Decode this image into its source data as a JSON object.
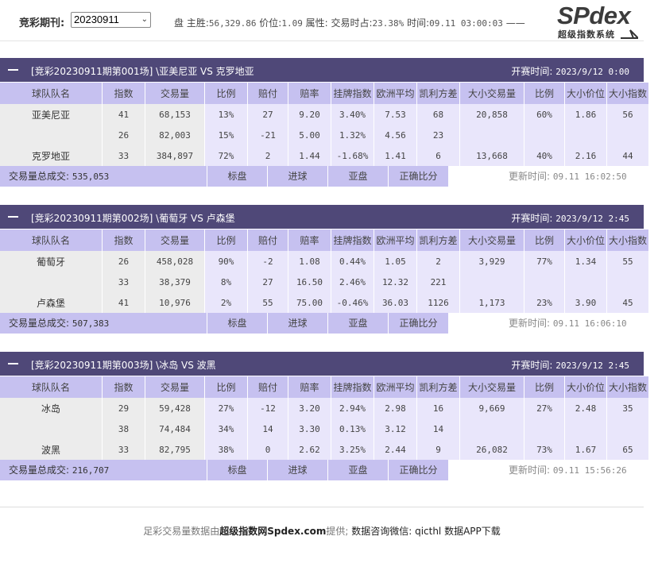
{
  "header": {
    "period_label": "竞彩期刊:",
    "period_value": "20230911",
    "info_prefix": "盘 主胜:",
    "info_main_win": "56,329.86",
    "info_price_label": " 价位:",
    "info_price": "1.09",
    "info_attr_label": " 属性: 交易时占:",
    "info_trade_pct": "23.38%",
    "info_time_label": " 时间:",
    "info_time": "09.11 03:00:03",
    "info_suffix": " ——",
    "logo_main": "SPdex",
    "logo_sub": "超级指数系统"
  },
  "columns": [
    "球队队名",
    "指数",
    "交易量",
    "比例",
    "赔付",
    "赔率",
    "挂牌指数",
    "欧洲平均",
    "凯利方差",
    "大小交易量",
    "比例",
    "大小价位",
    "大小指数"
  ],
  "footer_tabs": [
    "标盘",
    "进球",
    "亚盘",
    "正确比分"
  ],
  "total_label": "交易量总成交:",
  "update_label": "更新时间:",
  "kickoff_label": "开赛时间:",
  "matches": [
    {
      "title": "[竞彩20230911期第001场] \\亚美尼亚 VS 克罗地亚",
      "kickoff": "2023/9/12 0:00",
      "rows": [
        {
          "team": "亚美尼亚",
          "idx": "41",
          "vol": "68,153",
          "ratio": "13%",
          "pay": "27",
          "odds": "9.20",
          "list_idx": "3.40%",
          "eu_avg": "7.53",
          "kelly": "68",
          "ou_vol": "20,858",
          "ou_ratio": "60%",
          "ou_price": "1.86",
          "ou_idx": "56"
        },
        {
          "team": "",
          "idx": "26",
          "vol": "82,003",
          "ratio": "15%",
          "pay": "-21",
          "odds": "5.00",
          "list_idx": "1.32%",
          "eu_avg": "4.56",
          "kelly": "23",
          "ou_vol": "",
          "ou_ratio": "",
          "ou_price": "",
          "ou_idx": ""
        },
        {
          "team": "克罗地亚",
          "idx": "33",
          "vol": "384,897",
          "ratio": "72%",
          "pay": "2",
          "odds": "1.44",
          "list_idx": "-1.68%",
          "eu_avg": "1.41",
          "kelly": "6",
          "ou_vol": "13,668",
          "ou_ratio": "40%",
          "ou_price": "2.16",
          "ou_idx": "44"
        }
      ],
      "total": "535,053",
      "update": "09.11 16:02:50"
    },
    {
      "title": "[竞彩20230911期第002场] \\葡萄牙 VS 卢森堡",
      "kickoff": "2023/9/12 2:45",
      "rows": [
        {
          "team": "葡萄牙",
          "idx": "26",
          "vol": "458,028",
          "ratio": "90%",
          "pay": "-2",
          "odds": "1.08",
          "list_idx": "0.44%",
          "eu_avg": "1.05",
          "kelly": "2",
          "ou_vol": "3,929",
          "ou_ratio": "77%",
          "ou_price": "1.34",
          "ou_idx": "55"
        },
        {
          "team": "",
          "idx": "33",
          "vol": "38,379",
          "ratio": "8%",
          "pay": "27",
          "odds": "16.50",
          "list_idx": "2.46%",
          "eu_avg": "12.32",
          "kelly": "221",
          "ou_vol": "",
          "ou_ratio": "",
          "ou_price": "",
          "ou_idx": ""
        },
        {
          "team": "卢森堡",
          "idx": "41",
          "vol": "10,976",
          "ratio": "2%",
          "pay": "55",
          "odds": "75.00",
          "list_idx": "-0.46%",
          "eu_avg": "36.03",
          "kelly": "1126",
          "ou_vol": "1,173",
          "ou_ratio": "23%",
          "ou_price": "3.90",
          "ou_idx": "45"
        }
      ],
      "total": "507,383",
      "update": "09.11 16:06:10"
    },
    {
      "title": "[竞彩20230911期第003场] \\冰岛 VS 波黑",
      "kickoff": "2023/9/12 2:45",
      "rows": [
        {
          "team": "冰岛",
          "idx": "29",
          "vol": "59,428",
          "ratio": "27%",
          "pay": "-12",
          "odds": "3.20",
          "list_idx": "2.94%",
          "eu_avg": "2.98",
          "kelly": "16",
          "ou_vol": "9,669",
          "ou_ratio": "27%",
          "ou_price": "2.48",
          "ou_idx": "35"
        },
        {
          "team": "",
          "idx": "38",
          "vol": "74,484",
          "ratio": "34%",
          "pay": "14",
          "odds": "3.30",
          "list_idx": "0.13%",
          "eu_avg": "3.12",
          "kelly": "14",
          "ou_vol": "",
          "ou_ratio": "",
          "ou_price": "",
          "ou_idx": ""
        },
        {
          "team": "波黑",
          "idx": "33",
          "vol": "82,795",
          "ratio": "38%",
          "pay": "0",
          "odds": "2.62",
          "list_idx": "3.25%",
          "eu_avg": "2.44",
          "kelly": "9",
          "ou_vol": "26,082",
          "ou_ratio": "73%",
          "ou_price": "1.67",
          "ou_idx": "65"
        }
      ],
      "total": "216,707",
      "update": "09.11 15:56:26"
    }
  ],
  "footer": {
    "part1": "足彩交易量数据由",
    "part2": "超级指数网Spdex.com",
    "part3": "提供; ",
    "part4": "数据咨询微信: qicthl 数据APP下载"
  },
  "colors": {
    "header_bar": "#4f4878",
    "lavender": "#c6c1f0",
    "light_lavender": "#e9e6fb",
    "gray": "#ececec"
  }
}
